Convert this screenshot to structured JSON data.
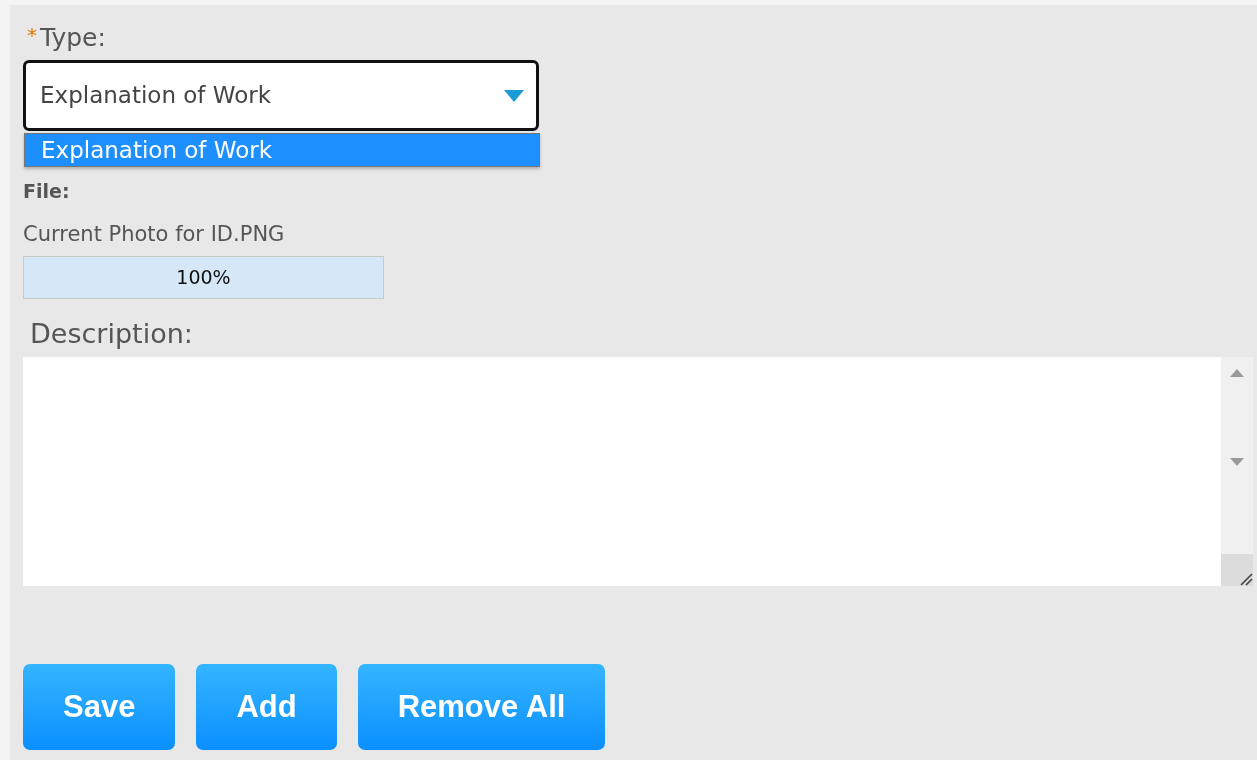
{
  "type_field": {
    "label": "Type:",
    "required": true,
    "required_mark": "*",
    "value": "Explanation of Work",
    "expanded": true,
    "options": [
      {
        "label": "Explanation of Work",
        "selected": true
      }
    ]
  },
  "file": {
    "label": "File:",
    "name": "Current Photo for ID.PNG",
    "progress": {
      "level": 1,
      "reading": "100%"
    }
  },
  "description": {
    "label": "Description:"
  },
  "buttons": [
    "Save",
    "Add",
    "Remove All"
  ]
}
